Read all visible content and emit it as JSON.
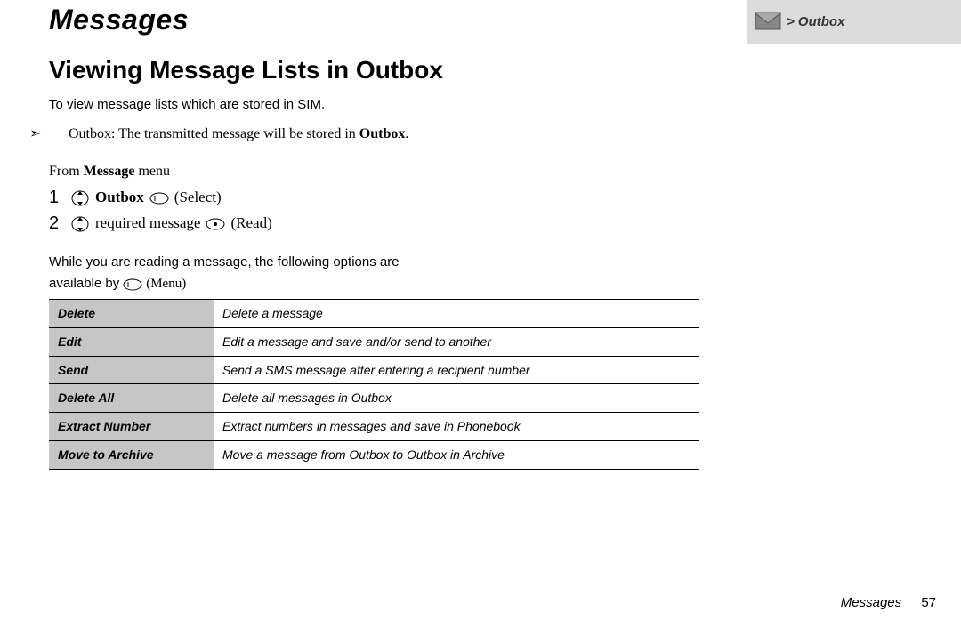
{
  "header": {
    "section_title": "Messages",
    "breadcrumb": "> Outbox"
  },
  "page": {
    "heading": "Viewing Message Lists in Outbox",
    "lead": "To view message lists which are stored in SIM.",
    "note_prefix": "Outbox: The transmitted message will be stored in ",
    "note_bold": "Outbox",
    "note_suffix": ".",
    "from_menu_prefix": "From ",
    "from_menu_bold": "Message",
    "from_menu_suffix": " menu",
    "steps": [
      {
        "num": "1",
        "target": "Outbox",
        "target_bold": true,
        "action": "(Select)",
        "action_icon": "softkey-left"
      },
      {
        "num": "2",
        "target": "required message",
        "target_bold": false,
        "action": "(Read)",
        "action_icon": "center-key"
      }
    ],
    "after_text": "While you are reading a message, the following options are",
    "available_by": "available by",
    "available_action": "(Menu)"
  },
  "options": [
    {
      "name": "Delete",
      "desc": "Delete a message"
    },
    {
      "name": "Edit",
      "desc": "Edit a message and save and/or send to another"
    },
    {
      "name": "Send",
      "desc": "Send a SMS message after entering a recipient number"
    },
    {
      "name": "Delete All",
      "desc": "Delete all messages in Outbox"
    },
    {
      "name": "Extract Number",
      "desc": "Extract numbers in messages and save in Phonebook"
    },
    {
      "name": "Move to Archive",
      "desc": "Move a message from Outbox to Outbox in Archive"
    }
  ],
  "footer": {
    "label": "Messages",
    "page_number": "57"
  }
}
